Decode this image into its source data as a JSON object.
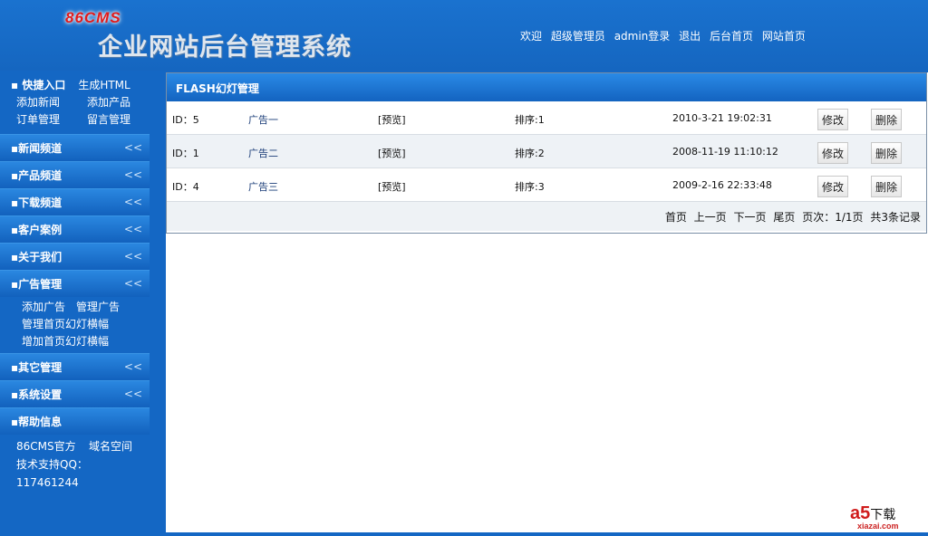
{
  "header": {
    "logo": "86CMS",
    "title": "企业网站后台管理系统",
    "nav": [
      "欢迎",
      "超级管理员",
      "admin登录",
      "退出",
      "后台首页",
      "网站首页"
    ]
  },
  "sidebar": {
    "quick": {
      "title": "快捷入口",
      "links": [
        "生成HTML",
        "添加新闻",
        "添加产品",
        "订单管理",
        "留言管理"
      ]
    },
    "sections": [
      "新闻频道",
      "产品频道",
      "下载频道",
      "客户案例",
      "关于我们",
      "广告管理"
    ],
    "ad_links": [
      "添加广告",
      "管理广告",
      "管理首页幻灯横幅",
      "增加首页幻灯横幅"
    ],
    "sections2": [
      "其它管理",
      "系统设置"
    ],
    "help": {
      "title": "帮助信息",
      "links": [
        "86CMS官方",
        "域名空间"
      ],
      "support": "技术支持QQ：117461244"
    },
    "chevron": "<<"
  },
  "panel": {
    "title": "FLASH幻灯管理",
    "rows": [
      {
        "id": "ID：5",
        "name": "广告一",
        "preview": "[预览]",
        "order": "排序:1",
        "time": "2010-3-21 19:02:31",
        "edit": "修改",
        "del": "删除"
      },
      {
        "id": "ID：1",
        "name": "广告二",
        "preview": "[预览]",
        "order": "排序:2",
        "time": "2008-11-19 11:10:12",
        "edit": "修改",
        "del": "删除"
      },
      {
        "id": "ID：4",
        "name": "广告三",
        "preview": "[预览]",
        "order": "排序:3",
        "time": "2009-2-16 22:33:48",
        "edit": "修改",
        "del": "删除"
      }
    ],
    "pager": {
      "first": "首页",
      "prev": "上一页",
      "next": "下一页",
      "last": "尾页",
      "page": "页次：1/1页",
      "total": "共3条记录"
    }
  },
  "watermark": {
    "brand": "a5",
    "text": "下载",
    "site": "xiazai.com"
  }
}
